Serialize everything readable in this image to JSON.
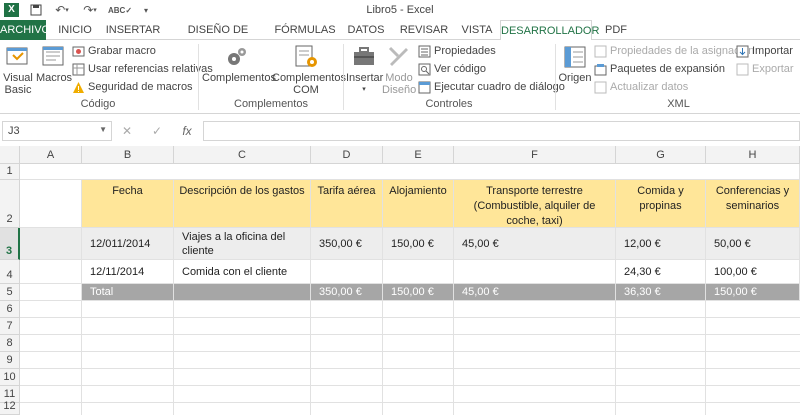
{
  "window": {
    "title": "Libro5 - Excel"
  },
  "qat": {
    "logo_letter": "X",
    "save_icon": "save-icon",
    "undo_icon": "undo-icon",
    "redo_icon": "redo-icon",
    "spell_icon": "spellcheck-icon"
  },
  "tabs": [
    "ARCHIVO",
    "INICIO",
    "INSERTAR",
    "DISEÑO DE PÁGINA",
    "FÓRMULAS",
    "DATOS",
    "REVISAR",
    "VISTA",
    "DESARROLLADOR",
    "PDF"
  ],
  "active_tab": "DESARROLLADOR",
  "ribbon": {
    "codigo": {
      "label": "Código",
      "visual_basic": "Visual Basic",
      "macros": "Macros",
      "grabar": "Grabar macro",
      "usar_ref": "Usar referencias relativas",
      "seguridad": "Seguridad de macros"
    },
    "complementos": {
      "label": "Complementos",
      "complementos": "Complementos",
      "com": "Complementos COM"
    },
    "controles": {
      "label": "Controles",
      "insertar": "Insertar",
      "modo": "Modo Diseño",
      "propiedades": "Propiedades",
      "ver_codigo": "Ver código",
      "ejecutar": "Ejecutar cuadro de diálogo"
    },
    "xml": {
      "label": "XML",
      "origen": "Origen",
      "prop_asig": "Propiedades de la asignación",
      "paquetes": "Paquetes de expansión",
      "actualizar": "Actualizar datos",
      "importar": "Importar",
      "exportar": "Exportar"
    }
  },
  "formula_bar": {
    "namebox": "J3",
    "fx": "fx",
    "cancel": "✕",
    "enter": "✓",
    "value": ""
  },
  "columns": [
    "A",
    "B",
    "C",
    "D",
    "E",
    "F",
    "G",
    "H"
  ],
  "rows": [
    "1",
    "2",
    "3",
    "4",
    "5",
    "6",
    "7",
    "8",
    "9",
    "10",
    "11",
    "12"
  ],
  "headers": {
    "b": "Fecha",
    "c": "Descripción de los gastos",
    "d": "Tarifa aérea",
    "e": "Alojamiento",
    "f": "Transporte terrestre (Combustible, alquiler de coche, taxi)",
    "g": "Comida y propinas",
    "h": "Conferencias y seminarios"
  },
  "row3": {
    "b": "12/011/2014",
    "c": "Viajes a la oficina del cliente",
    "d": "350,00 €",
    "e": "150,00 €",
    "f": "45,00 €",
    "g": "12,00 €",
    "h": "50,00 €"
  },
  "row4": {
    "b": "12/11/2014",
    "c": "Comida con el cliente",
    "d": "",
    "e": "",
    "f": "",
    "g": "24,30 €",
    "h": "100,00 €"
  },
  "row5": {
    "b": "Total",
    "c": "",
    "d": "350,00 €",
    "e": "150,00 €",
    "f": "45,00 €",
    "g": "36,30 €",
    "h": "150,00 €"
  },
  "colors": {
    "excel_green": "#217346",
    "header_fill": "#ffe699",
    "total_fill": "#a6a6a6",
    "row3_fill": "#ededed"
  }
}
